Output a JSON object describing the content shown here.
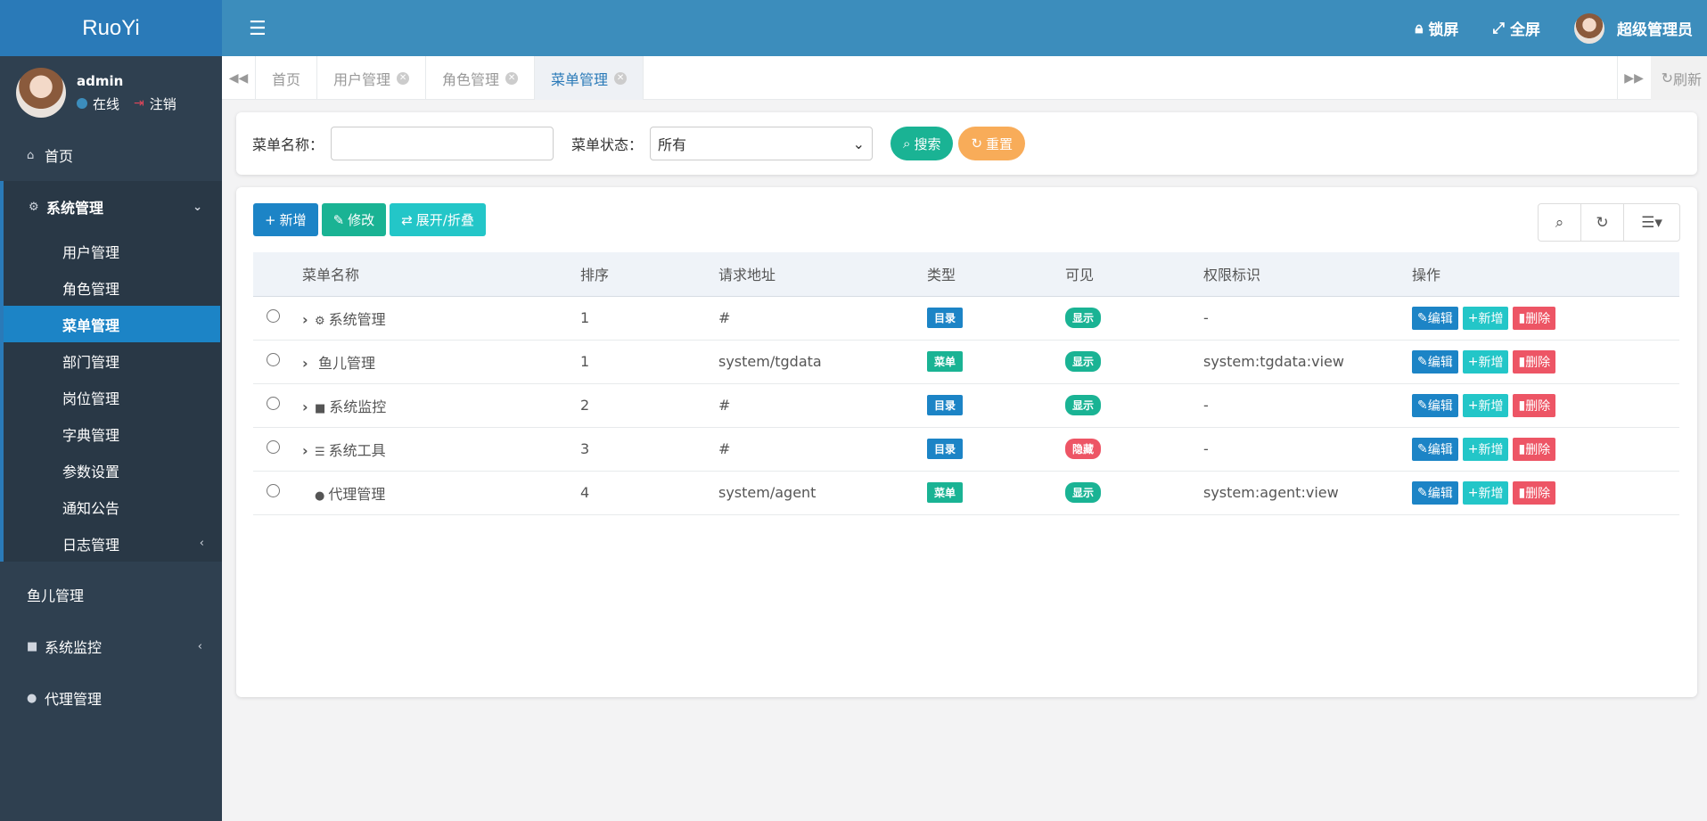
{
  "app": {
    "logo": "RuoYi"
  },
  "user": {
    "name": "admin",
    "status": "在线",
    "logout": "注销"
  },
  "topbar": {
    "lock": "锁屏",
    "fullscreen": "全屏",
    "account": "超级管理员"
  },
  "sidebar": {
    "home": "首页",
    "group": "系统管理",
    "sub": [
      "用户管理",
      "角色管理",
      "菜单管理",
      "部门管理",
      "岗位管理",
      "字典管理",
      "参数设置",
      "通知公告",
      "日志管理"
    ],
    "fish": "鱼儿管理",
    "monitor": "系统监控",
    "agent": "代理管理"
  },
  "tabs": [
    {
      "label": "首页"
    },
    {
      "label": "用户管理"
    },
    {
      "label": "角色管理"
    },
    {
      "label": "菜单管理"
    }
  ],
  "refresh": "刷新",
  "search": {
    "name_label": "菜单名称：",
    "status_label": "菜单状态：",
    "status_value": "所有",
    "search_btn": "搜索",
    "reset_btn": "重置"
  },
  "toolbar": {
    "add": "新增",
    "edit": "修改",
    "expand": "展开/折叠"
  },
  "table": {
    "headers": [
      "菜单名称",
      "排序",
      "请求地址",
      "类型",
      "可见",
      "权限标识",
      "操作"
    ],
    "rows": [
      {
        "name": "系统管理",
        "order": "1",
        "url": "#",
        "type": "目录",
        "visible": "显示",
        "perm": "-"
      },
      {
        "name": "鱼儿管理",
        "order": "1",
        "url": "system/tgdata",
        "type": "菜单",
        "visible": "显示",
        "perm": "system:tgdata:view"
      },
      {
        "name": "系统监控",
        "order": "2",
        "url": "#",
        "type": "目录",
        "visible": "显示",
        "perm": "-"
      },
      {
        "name": "系统工具",
        "order": "3",
        "url": "#",
        "type": "目录",
        "visible": "隐藏",
        "perm": "-"
      },
      {
        "name": "代理管理",
        "order": "4",
        "url": "system/agent",
        "type": "菜单",
        "visible": "显示",
        "perm": "system:agent:view"
      }
    ],
    "ops": {
      "edit": "编辑",
      "add": "新增",
      "del": "删除"
    }
  },
  "colors": {
    "primary": "#1c84c6",
    "success": "#1ab394",
    "info": "#23c6c8",
    "warning": "#f8ac59",
    "danger": "#ed5565",
    "sidebar": "#2f4050",
    "header": "#3c8dbc"
  }
}
